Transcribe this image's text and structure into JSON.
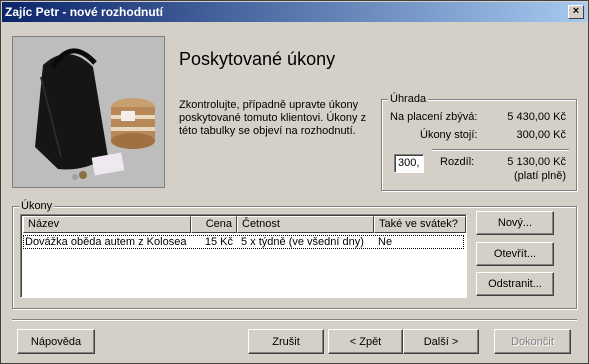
{
  "window": {
    "title": "Zajíc Petr - nové rozhodnutí",
    "close_label": "×"
  },
  "header": {
    "heading": "Poskytované úkony",
    "description": "Zkontrolujte, případně upravte úkony poskytované tomuto klientovi. Úkony z této tabulky se objeví na rozhodnutí."
  },
  "payment": {
    "legend": "Úhrada",
    "remaining_label": "Na placení zbývá:",
    "remaining_value": "5 430,00 Kč",
    "cost_label": "Úkony stojí:",
    "cost_value": "300,00 Kč",
    "input_value": "300,",
    "diff_label": "Rozdíl:",
    "diff_value": "5 130,00 Kč",
    "diff_note": "(platí plně)"
  },
  "services": {
    "legend": "Úkony",
    "columns": [
      "Název",
      "Cena",
      "Četnost",
      "Také ve svátek?"
    ],
    "rows": [
      {
        "name": "Dovážka oběda autem z Kolosea",
        "price": "15 Kč",
        "frequency": "5 x týdně (ve všední dny)",
        "holiday": "Ne"
      }
    ],
    "new_button": "Nový...",
    "open_button": "Otevřít...",
    "remove_button": "Odstranit..."
  },
  "footer": {
    "help": "Nápověda",
    "cancel": "Zrušit",
    "back": "< Zpět",
    "next": "Další >",
    "finish": "Dokončit"
  }
}
